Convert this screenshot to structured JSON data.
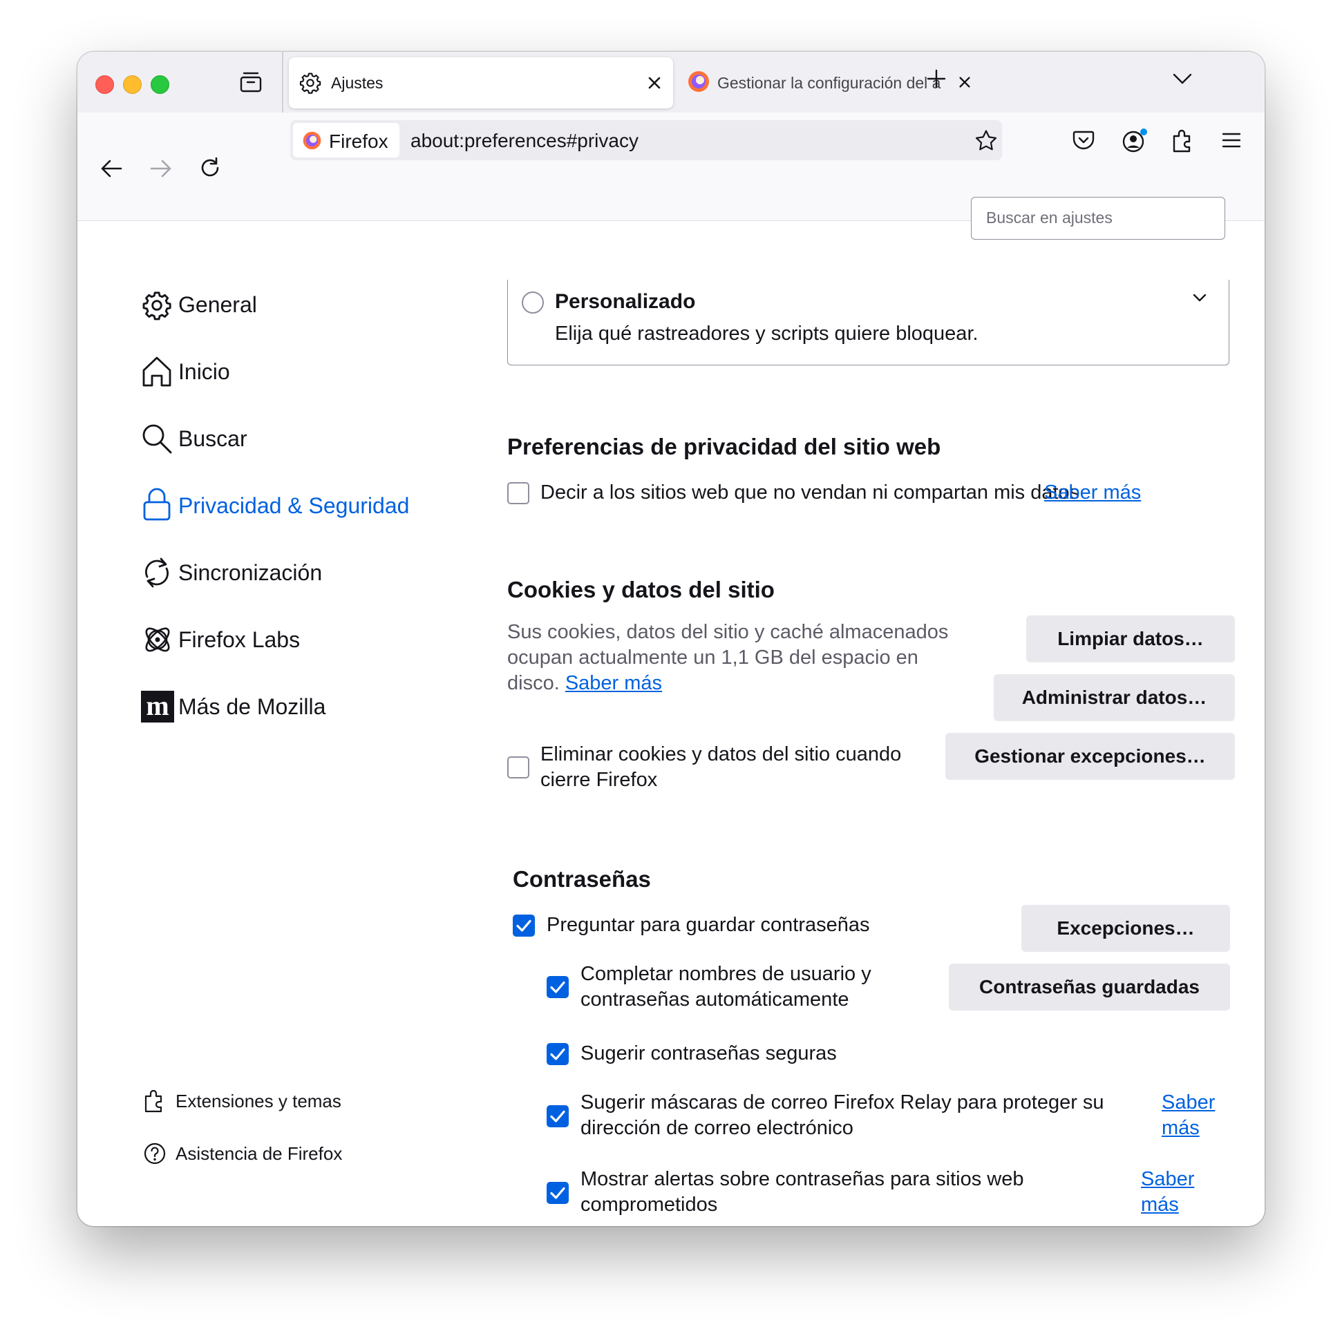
{
  "tabs": {
    "active": {
      "title": "Ajustes"
    },
    "inactive": {
      "title": "Gestionar la configuración del a"
    }
  },
  "urlbar": {
    "identity_label": "Firefox",
    "url": "about:preferences#privacy"
  },
  "search": {
    "placeholder": "Buscar en ajustes"
  },
  "sidebar": {
    "items": [
      {
        "label": "General",
        "icon": "gear-icon"
      },
      {
        "label": "Inicio",
        "icon": "home-icon"
      },
      {
        "label": "Buscar",
        "icon": "search-icon"
      },
      {
        "label": "Privacidad & Seguridad",
        "icon": "lock-icon",
        "selected": true
      },
      {
        "label": "Sincronización",
        "icon": "sync-icon"
      },
      {
        "label": "Firefox Labs",
        "icon": "atom-icon"
      },
      {
        "label": "Más de Mozilla",
        "icon": "mozilla-m-icon"
      }
    ],
    "footer": [
      {
        "label": "Extensiones y temas",
        "icon": "puzzle-icon"
      },
      {
        "label": "Asistencia de Firefox",
        "icon": "help-icon"
      }
    ]
  },
  "tracking": {
    "custom_title": "Personalizado",
    "custom_desc": "Elija qué rastreadores y scripts quiere bloquear."
  },
  "site_privacy": {
    "heading": "Preferencias de privacidad del sitio web",
    "checkbox_label": "Decir a los sitios web que no vendan ni compartan mis datos",
    "learn_more": "Saber más"
  },
  "cookies": {
    "heading": "Cookies y datos del sitio",
    "usage_text": "Sus cookies, datos del sitio y caché almacenados ocupan actualmente un 1,1 GB del espacio en disco.",
    "learn_more": "Saber más",
    "clear_button": "Limpiar datos…",
    "manage_button": "Administrar datos…",
    "exceptions_button": "Gestionar excepciones…",
    "delete_on_close_label": "Eliminar cookies y datos del sitio cuando cierre Firefox"
  },
  "passwords": {
    "heading": "Contraseñas",
    "ask_save": "Preguntar para guardar contraseñas",
    "autofill": "Completar nombres de usuario y contraseñas automáticamente",
    "suggest_strong": "Sugerir contraseñas seguras",
    "relay_masks": "Sugerir máscaras de correo Firefox Relay para proteger su dirección de correo electrónico",
    "breach_alerts": "Mostrar alertas sobre contraseñas para sitios web comprometidos",
    "learn_more": "Saber más",
    "exceptions_button": "Excepciones…",
    "saved_button": "Contraseñas guardadas"
  },
  "colors": {
    "accent": "#0061e0",
    "button_bg": "#e9e9ed",
    "tabbar_bg": "#f0f0f4"
  }
}
